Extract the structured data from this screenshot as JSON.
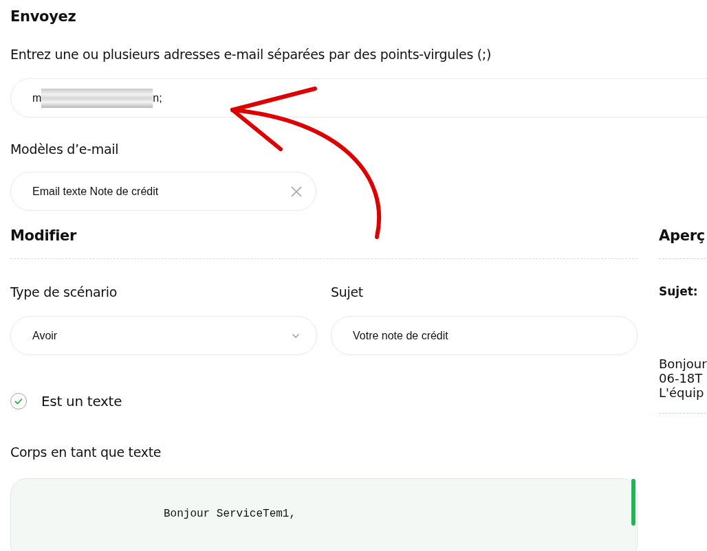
{
  "title": "Envoyez",
  "recipients": {
    "label": "Entrez une ou plusieurs adresses e-mail séparées par des points-virgules (;)",
    "value_start": "m",
    "value_end": "n;",
    "redacted": true
  },
  "template": {
    "label": "Modèles d’e-mail",
    "value": "Email texte Note de crédit"
  },
  "edit": {
    "title": "Modifier",
    "scenario": {
      "label": "Type de scénario",
      "value": "Avoir"
    },
    "subject": {
      "label": "Sujet",
      "value": "Votre note de crédit"
    },
    "is_text": {
      "label": "Est un texte",
      "checked": true
    },
    "body": {
      "label": "Corps en tant que texte",
      "value": "Bonjour ServiceTem1,"
    }
  },
  "preview": {
    "title": "Aperç",
    "subject_label": "Sujet:",
    "lines": [
      "Bonjour",
      "06-18T",
      "L'équip"
    ]
  },
  "annotation": {
    "kind": "arrow"
  }
}
